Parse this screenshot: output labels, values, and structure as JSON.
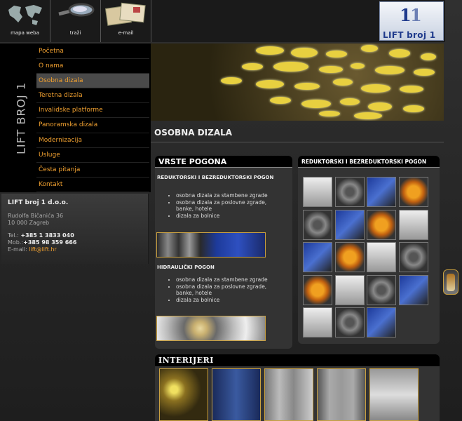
{
  "topnav": [
    {
      "label": "mapa weba",
      "icon": "world-map-icon"
    },
    {
      "label": "traži",
      "icon": "magnifier-icon"
    },
    {
      "label": "e-mail",
      "icon": "envelope-icon"
    }
  ],
  "logo": {
    "mark": "1",
    "text": "LIFT broj 1"
  },
  "vertical_logo": "LIFT BROJ 1",
  "menu": [
    {
      "label": "Početna",
      "active": false
    },
    {
      "label": "O nama",
      "active": false
    },
    {
      "label": "Osobna dizala",
      "active": true
    },
    {
      "label": "Teretna dizala",
      "active": false
    },
    {
      "label": "Invalidske platforme",
      "active": false
    },
    {
      "label": "Panoramska dizala",
      "active": false
    },
    {
      "label": "Modernizacija",
      "active": false
    },
    {
      "label": "Usluge",
      "active": false
    },
    {
      "label": "Česta pitanja",
      "active": false
    },
    {
      "label": "Kontakt",
      "active": false
    }
  ],
  "company": {
    "name": "LIFT broj 1 d.o.o.",
    "street": "Rudolfa Bičanića 36",
    "city": "10 000 Zagreb",
    "tel_label": "Tel.:",
    "tel": "+385 1 3833 040",
    "mob_label": "Mob.:",
    "mob": "+385 98 359 666",
    "email_label": "E-mail:",
    "email": "lift@lift.hr"
  },
  "page_title": "OSOBNA DIZALA",
  "vrste_pogona": {
    "title": "VRSTE POGONA",
    "section1": {
      "heading": "REDUKTORSKI I BEZREDUKTORSKI POGON",
      "items": [
        "osobna dizala za stambene zgrade",
        "osobna dizala za poslovne zgrade, banke, hotele",
        "dizala za bolnice"
      ]
    },
    "section2": {
      "heading": "HIDRAULIČKI POGON",
      "items": [
        "osobna dizala za stambene zgrade",
        "osobna dizala za poslovne zgrade, banke, hotele",
        "dizala za bolnice"
      ]
    }
  },
  "reduktorski": {
    "title": "REDUKTORSKI I BEZREDUKTORSKI POGON",
    "thumb_count": 19
  },
  "interijeri": {
    "title": "INTERIJERI",
    "thumb_count": 5
  },
  "colors": {
    "accent": "#f0a030",
    "frame": "#c9a040",
    "background": "#2a2a2a",
    "active_menu": "#4a4a4a"
  }
}
